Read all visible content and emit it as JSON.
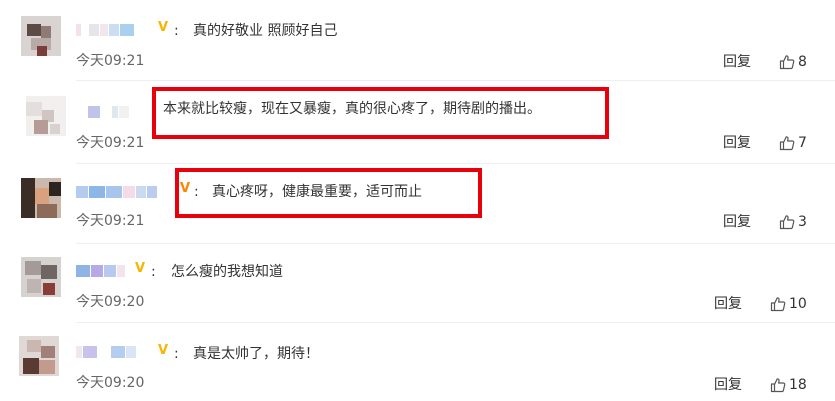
{
  "comments": [
    {
      "colon": ":",
      "text": "真的好敬业 照顾好自己",
      "time": "今天09:21",
      "reply_label": "回复",
      "likes": "8",
      "verified_icon": "verified-v-gold-icon"
    },
    {
      "colon": "",
      "text": "本来就比较瘦，现在又暴瘦，真的很心疼了，期待剧的播出。",
      "time": "今天09:21",
      "reply_label": "回复",
      "likes": "7",
      "highlighted": true
    },
    {
      "colon": ":",
      "text": "真心疼呀，健康最重要，适可而止",
      "time": "今天09:21",
      "reply_label": "回复",
      "likes": "3",
      "verified_icon": "verified-v-orange-icon",
      "highlighted": true
    },
    {
      "colon": ":",
      "text": "怎么瘦的我想知道",
      "time": "今天09:20",
      "reply_label": "回复",
      "likes": "10",
      "verified_icon": "verified-v-gold-icon"
    },
    {
      "colon": ":",
      "text": "真是太帅了，期待！",
      "time": "今天09:20",
      "reply_label": "回复",
      "likes": "18",
      "verified_icon": "verified-v-gold-icon"
    }
  ],
  "colors": {
    "highlight_border": "#e8000b",
    "verified_gold": "#f7b500",
    "verified_orange": "#ff8200",
    "separator": "#eeeeee",
    "timestamp": "#666666"
  },
  "icons": {
    "like": "thumbs-up-icon",
    "verified": "verified-v-icon"
  }
}
